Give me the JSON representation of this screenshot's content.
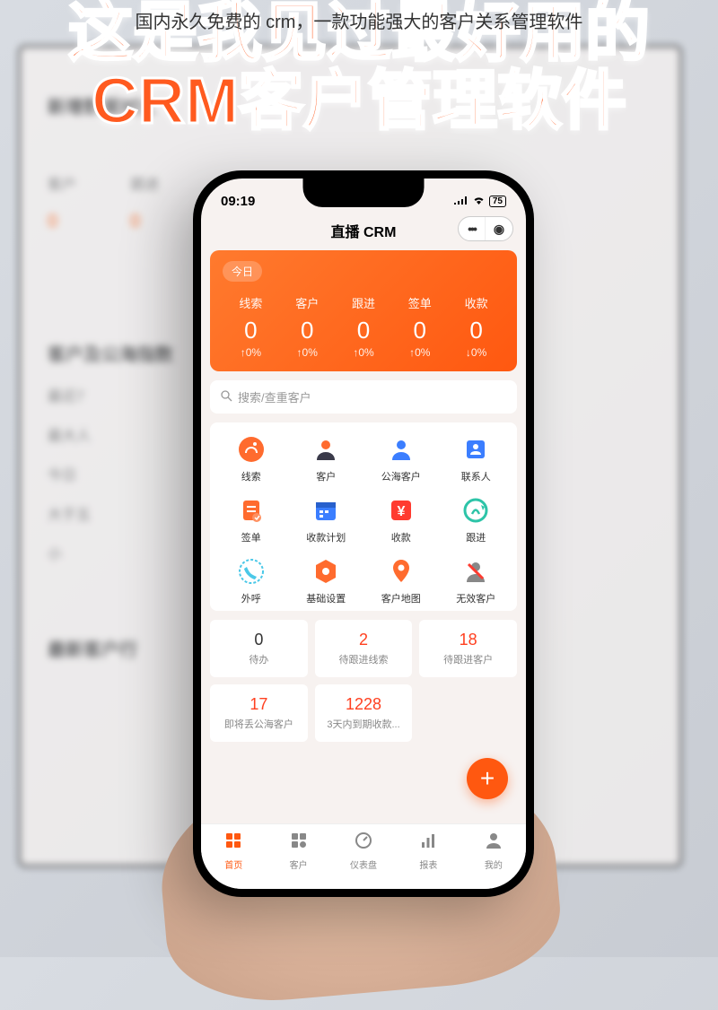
{
  "caption": "国内永久免费的 crm，一款功能强大的客户关系管理软件",
  "headline_l1": "这是我见过最好用的",
  "headline_l2": "CRM客户管理软件",
  "status": {
    "time": "09:19",
    "battery": "75"
  },
  "app_title": "直播 CRM",
  "today_label": "今日",
  "metrics": [
    {
      "label": "线索",
      "value": "0",
      "change": "↑0%"
    },
    {
      "label": "客户",
      "value": "0",
      "change": "↑0%"
    },
    {
      "label": "跟进",
      "value": "0",
      "change": "↑0%"
    },
    {
      "label": "签单",
      "value": "0",
      "change": "↑0%"
    },
    {
      "label": "收款",
      "value": "0",
      "change": "↓0%"
    }
  ],
  "search_placeholder": "搜索/查重客户",
  "grid": [
    {
      "label": "线索",
      "name": "lead-icon"
    },
    {
      "label": "客户",
      "name": "customer-icon"
    },
    {
      "label": "公海客户",
      "name": "pool-customer-icon"
    },
    {
      "label": "联系人",
      "name": "contact-icon"
    },
    {
      "label": "签单",
      "name": "order-icon"
    },
    {
      "label": "收款计划",
      "name": "payment-plan-icon"
    },
    {
      "label": "收款",
      "name": "payment-icon"
    },
    {
      "label": "跟进",
      "name": "followup-icon"
    },
    {
      "label": "外呼",
      "name": "outcall-icon"
    },
    {
      "label": "基础设置",
      "name": "settings-icon"
    },
    {
      "label": "客户地图",
      "name": "map-icon"
    },
    {
      "label": "无效客户",
      "name": "invalid-customer-icon"
    }
  ],
  "cards": [
    {
      "num": "0",
      "label": "待办",
      "cls": "zero"
    },
    {
      "num": "2",
      "label": "待跟进线索",
      "cls": "red"
    },
    {
      "num": "18",
      "label": "待跟进客户",
      "cls": "red"
    },
    {
      "num": "17",
      "label": "即将丢公海客户",
      "cls": "red"
    },
    {
      "num": "1228",
      "label": "3天内到期收款...",
      "cls": "red"
    }
  ],
  "tabs": [
    {
      "label": "首页",
      "name": "tab-home",
      "active": true
    },
    {
      "label": "客户",
      "name": "tab-customer",
      "active": false
    },
    {
      "label": "仪表盘",
      "name": "tab-dashboard",
      "active": false
    },
    {
      "label": "报表",
      "name": "tab-report",
      "active": false
    },
    {
      "label": "我的",
      "name": "tab-mine",
      "active": false
    }
  ],
  "bg": {
    "section1": "新增数据对比",
    "col1": "客户",
    "col2": "跟进",
    "section2": "客户及公海指数",
    "section3": "最新客户行"
  }
}
